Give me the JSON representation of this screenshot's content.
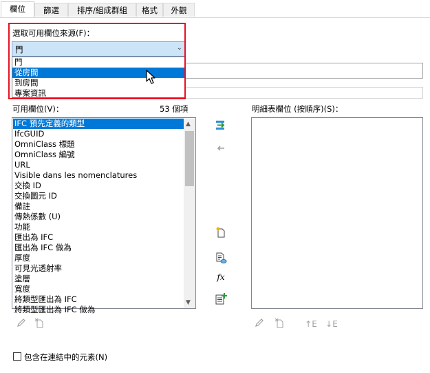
{
  "tabs": [
    "欄位",
    "篩選",
    "排序/組成群組",
    "格式",
    "外觀"
  ],
  "source": {
    "label": "選取可用欄位來源(F)：",
    "selected": "門",
    "options": [
      "門",
      "從房間",
      "到房間",
      "專案資訊"
    ],
    "highlighted_index": 1
  },
  "available": {
    "label": "可用欄位(V)：",
    "count": "53 個項",
    "items": [
      "IFC 預先定義的類型",
      "IfcGUID",
      "OmniClass 標題",
      "OmniClass 編號",
      "URL",
      "Visible dans les nomenclatures",
      "交換 ID",
      "交換圖元 ID",
      "備註",
      "傳熱係數 (U)",
      "功能",
      "匯出為 IFC",
      "匯出為 IFC 做為",
      "厚度",
      "可見光透射率",
      "塗層",
      "寬度",
      "將類型匯出為 IFC",
      "將類型匯出為 IFC 做為"
    ]
  },
  "scheduled": {
    "label": "明細表欄位 (按順序)(S)："
  },
  "include_linked": {
    "label": "包含在連結中的元素(N)",
    "checked": false
  },
  "icons": {
    "add": "add-field-icon",
    "remove": "remove-field-icon",
    "new_parameter": "new-parameter-icon",
    "combine": "combine-parameters-icon",
    "calculated": "calculated-value-icon",
    "add_param_list": "add-parameter-icon",
    "edit": "edit-icon",
    "delete": "delete-icon",
    "move_up": "move-up-icon",
    "move_down": "move-down-icon"
  },
  "colors": {
    "highlight": "#0078d7",
    "annotation_box": "#e81123",
    "combo_bg": "#cce4f7"
  }
}
